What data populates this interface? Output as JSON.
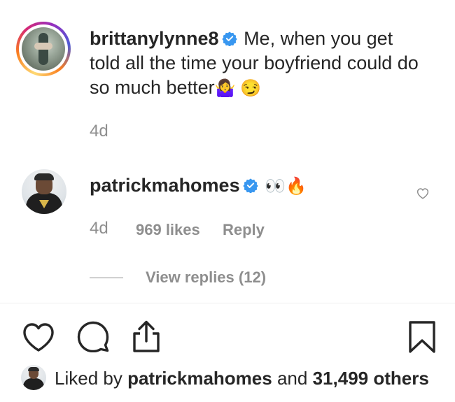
{
  "caption_comment": {
    "username": "brittanylynne8",
    "text": "Me, when you get told all the time your boyfriend could do so much better",
    "emoji": "🤷‍♀️ 😏",
    "time": "4d"
  },
  "reply_comment": {
    "username": "patrickmahomes",
    "emoji": "👀🔥",
    "time": "4d",
    "likes": "969 likes",
    "reply_label": "Reply",
    "view_replies": "View replies (12)"
  },
  "liked_by": {
    "prefix": "Liked by",
    "user": "patrickmahomes",
    "middle": "and",
    "others": "31,499 others"
  },
  "icons": {
    "verified": "verified-badge-icon",
    "like": "heart-icon",
    "comment": "comment-bubble-icon",
    "share": "share-icon",
    "save": "bookmark-icon"
  },
  "colors": {
    "text": "#262626",
    "muted": "#8e8e8e",
    "verified": "#3897f0"
  }
}
